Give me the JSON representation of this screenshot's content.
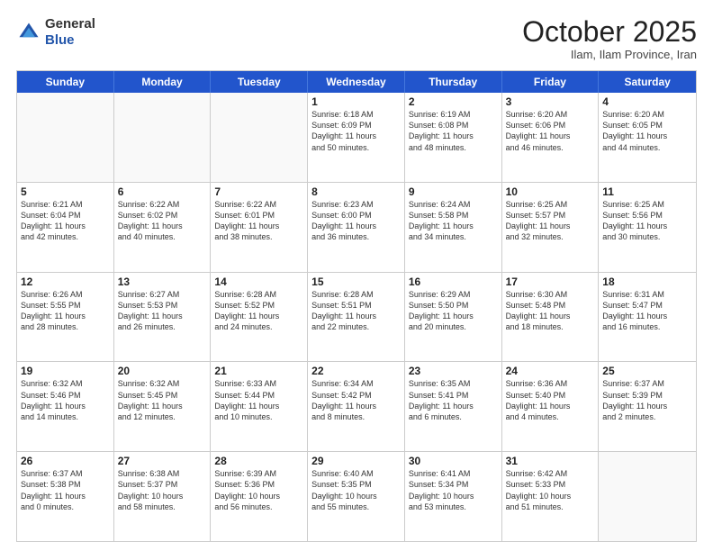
{
  "header": {
    "logo_line1": "General",
    "logo_line2": "Blue",
    "month": "October 2025",
    "location": "Ilam, Ilam Province, Iran"
  },
  "weekdays": [
    "Sunday",
    "Monday",
    "Tuesday",
    "Wednesday",
    "Thursday",
    "Friday",
    "Saturday"
  ],
  "rows": [
    [
      {
        "day": "",
        "text": ""
      },
      {
        "day": "",
        "text": ""
      },
      {
        "day": "",
        "text": ""
      },
      {
        "day": "1",
        "text": "Sunrise: 6:18 AM\nSunset: 6:09 PM\nDaylight: 11 hours\nand 50 minutes."
      },
      {
        "day": "2",
        "text": "Sunrise: 6:19 AM\nSunset: 6:08 PM\nDaylight: 11 hours\nand 48 minutes."
      },
      {
        "day": "3",
        "text": "Sunrise: 6:20 AM\nSunset: 6:06 PM\nDaylight: 11 hours\nand 46 minutes."
      },
      {
        "day": "4",
        "text": "Sunrise: 6:20 AM\nSunset: 6:05 PM\nDaylight: 11 hours\nand 44 minutes."
      }
    ],
    [
      {
        "day": "5",
        "text": "Sunrise: 6:21 AM\nSunset: 6:04 PM\nDaylight: 11 hours\nand 42 minutes."
      },
      {
        "day": "6",
        "text": "Sunrise: 6:22 AM\nSunset: 6:02 PM\nDaylight: 11 hours\nand 40 minutes."
      },
      {
        "day": "7",
        "text": "Sunrise: 6:22 AM\nSunset: 6:01 PM\nDaylight: 11 hours\nand 38 minutes."
      },
      {
        "day": "8",
        "text": "Sunrise: 6:23 AM\nSunset: 6:00 PM\nDaylight: 11 hours\nand 36 minutes."
      },
      {
        "day": "9",
        "text": "Sunrise: 6:24 AM\nSunset: 5:58 PM\nDaylight: 11 hours\nand 34 minutes."
      },
      {
        "day": "10",
        "text": "Sunrise: 6:25 AM\nSunset: 5:57 PM\nDaylight: 11 hours\nand 32 minutes."
      },
      {
        "day": "11",
        "text": "Sunrise: 6:25 AM\nSunset: 5:56 PM\nDaylight: 11 hours\nand 30 minutes."
      }
    ],
    [
      {
        "day": "12",
        "text": "Sunrise: 6:26 AM\nSunset: 5:55 PM\nDaylight: 11 hours\nand 28 minutes."
      },
      {
        "day": "13",
        "text": "Sunrise: 6:27 AM\nSunset: 5:53 PM\nDaylight: 11 hours\nand 26 minutes."
      },
      {
        "day": "14",
        "text": "Sunrise: 6:28 AM\nSunset: 5:52 PM\nDaylight: 11 hours\nand 24 minutes."
      },
      {
        "day": "15",
        "text": "Sunrise: 6:28 AM\nSunset: 5:51 PM\nDaylight: 11 hours\nand 22 minutes."
      },
      {
        "day": "16",
        "text": "Sunrise: 6:29 AM\nSunset: 5:50 PM\nDaylight: 11 hours\nand 20 minutes."
      },
      {
        "day": "17",
        "text": "Sunrise: 6:30 AM\nSunset: 5:48 PM\nDaylight: 11 hours\nand 18 minutes."
      },
      {
        "day": "18",
        "text": "Sunrise: 6:31 AM\nSunset: 5:47 PM\nDaylight: 11 hours\nand 16 minutes."
      }
    ],
    [
      {
        "day": "19",
        "text": "Sunrise: 6:32 AM\nSunset: 5:46 PM\nDaylight: 11 hours\nand 14 minutes."
      },
      {
        "day": "20",
        "text": "Sunrise: 6:32 AM\nSunset: 5:45 PM\nDaylight: 11 hours\nand 12 minutes."
      },
      {
        "day": "21",
        "text": "Sunrise: 6:33 AM\nSunset: 5:44 PM\nDaylight: 11 hours\nand 10 minutes."
      },
      {
        "day": "22",
        "text": "Sunrise: 6:34 AM\nSunset: 5:42 PM\nDaylight: 11 hours\nand 8 minutes."
      },
      {
        "day": "23",
        "text": "Sunrise: 6:35 AM\nSunset: 5:41 PM\nDaylight: 11 hours\nand 6 minutes."
      },
      {
        "day": "24",
        "text": "Sunrise: 6:36 AM\nSunset: 5:40 PM\nDaylight: 11 hours\nand 4 minutes."
      },
      {
        "day": "25",
        "text": "Sunrise: 6:37 AM\nSunset: 5:39 PM\nDaylight: 11 hours\nand 2 minutes."
      }
    ],
    [
      {
        "day": "26",
        "text": "Sunrise: 6:37 AM\nSunset: 5:38 PM\nDaylight: 11 hours\nand 0 minutes."
      },
      {
        "day": "27",
        "text": "Sunrise: 6:38 AM\nSunset: 5:37 PM\nDaylight: 10 hours\nand 58 minutes."
      },
      {
        "day": "28",
        "text": "Sunrise: 6:39 AM\nSunset: 5:36 PM\nDaylight: 10 hours\nand 56 minutes."
      },
      {
        "day": "29",
        "text": "Sunrise: 6:40 AM\nSunset: 5:35 PM\nDaylight: 10 hours\nand 55 minutes."
      },
      {
        "day": "30",
        "text": "Sunrise: 6:41 AM\nSunset: 5:34 PM\nDaylight: 10 hours\nand 53 minutes."
      },
      {
        "day": "31",
        "text": "Sunrise: 6:42 AM\nSunset: 5:33 PM\nDaylight: 10 hours\nand 51 minutes."
      },
      {
        "day": "",
        "text": ""
      }
    ]
  ]
}
